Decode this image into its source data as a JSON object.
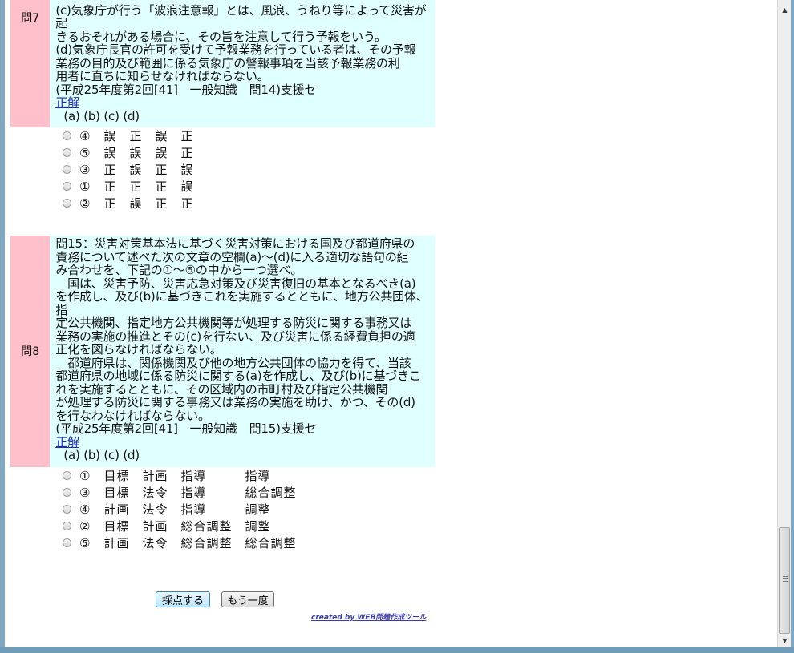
{
  "q7": {
    "number": "問7",
    "lines": [
      "(c)気象庁が行う「波浪注意報」とは、風浪、うねり等によって災害が起",
      "きるおそれがある場合に、その旨を注意して行う予報をいう。",
      "(d)気象庁長官の許可を受けて予報業務を行っている者は、その予報",
      "業務の目的及び範囲に係る気象庁の警報事項を当該予報業務の利",
      "用者に直ちに知らせなければならない。",
      "(平成25年度第2回[41]　一般知識　問14)支援セ"
    ],
    "answer_link": "正解",
    "columns": "(a)  (b)  (c)  (d)",
    "options": [
      "④　誤　正　誤　正",
      "⑤　誤　誤　誤　正",
      "③　正　誤　正　誤",
      "①　正　正　正　誤",
      "②　正　誤　正　正"
    ]
  },
  "q8": {
    "number": "問8",
    "lines": [
      "問15：災害対策基本法に基づく災害対策における国及び都道府県の",
      "責務について述べた次の文章の空欄(a)～(d)に入る適切な語句の組",
      "み合わせを、下記の①～⑤の中から一つ選べ。",
      "　国は、災害予防、災害応急対策及び災害復旧の基本となるべき(a)",
      "を作成し、及び(b)に基づきこれを実施するとともに、地方公共団体、指",
      "定公共機関、指定地方公共機関等が処理する防災に関する事務又は",
      "業務の実施の推進とその(c)を行ない、及び災害に係る経費負担の適",
      "正化を図らなければならない。",
      "　都道府県は、関係機関及び他の地方公共団体の協力を得て、当該",
      "都道府県の地域に係る防災に関する(a)を作成し、及び(b)に基づきこ",
      "れを実施するとともに、その区域内の市町村及び指定公共機関",
      "が処理する防災に関する事務又は業務の実施を助け、かつ、その(d)",
      "を行なわなければならない。",
      "(平成25年度第2回[41]　一般知識　問15)支援セ"
    ],
    "answer_link": "正解",
    "columns": "(a)  (b)  (c)  (d)",
    "options": [
      "①　目標　計画　指導　　　指導",
      "③　目標　法令　指導　　　総合調整",
      "④　計画　法令　指導　　　調整",
      "②　目標　計画　総合調整　調整",
      "⑤　計画　法令　総合調整　総合調整"
    ]
  },
  "buttons": {
    "grade": "採点する",
    "retry": "もう一度"
  },
  "credit": "created by WEB問題作成ツール"
}
